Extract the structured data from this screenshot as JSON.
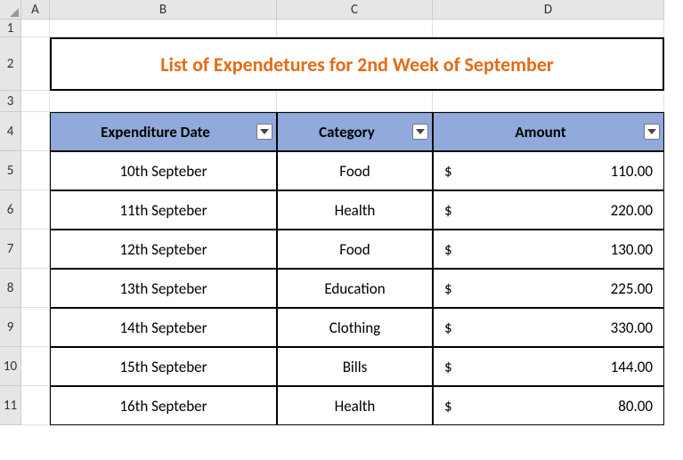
{
  "columns": [
    "A",
    "B",
    "C",
    "D"
  ],
  "rows": [
    "1",
    "2",
    "3",
    "4",
    "5",
    "6",
    "7",
    "8",
    "9",
    "10",
    "11"
  ],
  "title": "List of Expendetures for 2nd  Week of September",
  "headers": {
    "date": "Expenditure Date",
    "category": "Category",
    "amount": "Amount"
  },
  "currency_symbol": "$",
  "chart_data": {
    "type": "table",
    "columns": [
      "Expenditure Date",
      "Category",
      "Amount"
    ],
    "rows": [
      {
        "date": "10th Septeber",
        "category": "Food",
        "amount": "110.00"
      },
      {
        "date": "11th Septeber",
        "category": "Health",
        "amount": "220.00"
      },
      {
        "date": "12th Septeber",
        "category": "Food",
        "amount": "130.00"
      },
      {
        "date": "13th Septeber",
        "category": "Education",
        "amount": "225.00"
      },
      {
        "date": "14th Septeber",
        "category": "Clothing",
        "amount": "330.00"
      },
      {
        "date": "15th Septeber",
        "category": "Bills",
        "amount": "144.00"
      },
      {
        "date": "16th Septeber",
        "category": "Health",
        "amount": "80.00"
      }
    ]
  }
}
